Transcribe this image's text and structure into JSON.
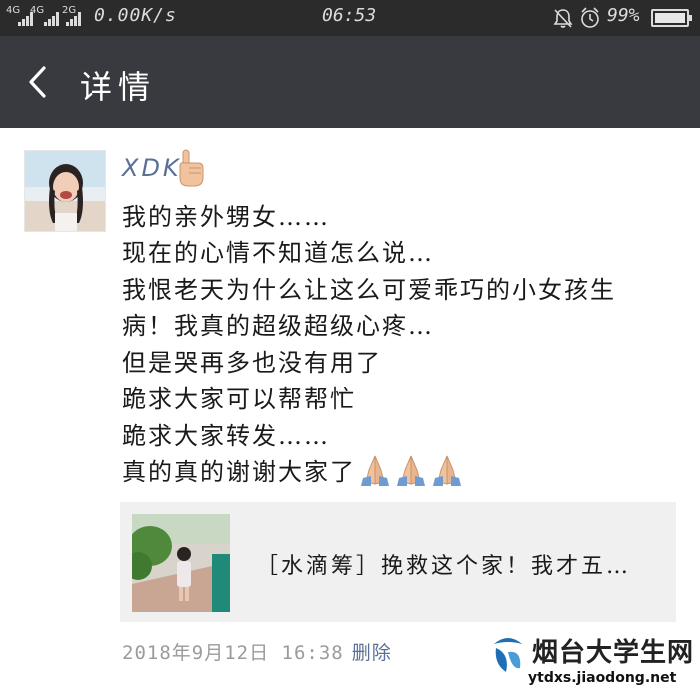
{
  "status_bar": {
    "network_1": "4G",
    "network_2": "4G",
    "network_3": "2G",
    "speed": "0.00K/s",
    "time": "06:53",
    "battery": "99%"
  },
  "header": {
    "title": "详情",
    "back_icon": "chevron-left-icon"
  },
  "post": {
    "author": "XDK",
    "lines": [
      "我的亲外甥女……",
      "现在的心情不知道怎么说…",
      "我恨老天为什么让这么可爱乖巧的小女孩生",
      "病！我真的超级超级心疼…",
      "但是哭再多也没有用了",
      "跪求大家可以帮帮忙",
      "跪求大家转发……",
      "真的真的谢谢大家了"
    ],
    "shared_link": {
      "title": "［水滴筹］挽救这个家！我才五…"
    },
    "timestamp": "2018年9月12日  16:38",
    "delete_label": "删除"
  },
  "watermark": {
    "name": "烟台大学生网",
    "url": "ytdxs.jiaodong.net"
  },
  "colors": {
    "status_bar_bg": "#2b2b2b",
    "header_bg": "#393a3f",
    "name_link": "#5a6f96",
    "card_bg": "#f0f0f0"
  }
}
